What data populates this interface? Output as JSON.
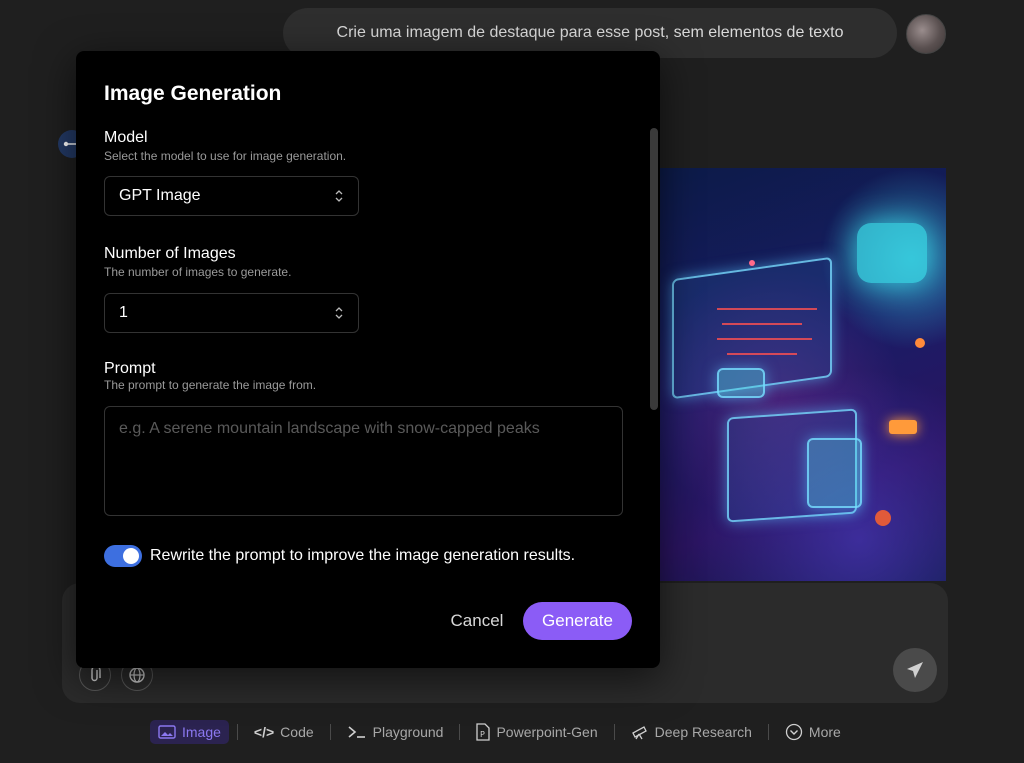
{
  "chat": {
    "user_message": "Crie uma imagem de destaque para esse post, sem elementos de texto"
  },
  "modal": {
    "title": "Image Generation",
    "model": {
      "label": "Model",
      "description": "Select the model to use for image generation.",
      "value": "GPT Image"
    },
    "num_images": {
      "label": "Number of Images",
      "description": "The number of images to generate.",
      "value": "1"
    },
    "prompt": {
      "label": "Prompt",
      "description": "The prompt to generate the image from.",
      "placeholder": "e.g. A serene mountain landscape with snow-capped peaks",
      "value": ""
    },
    "rewrite": {
      "label": "Rewrite the prompt to improve the image generation results.",
      "enabled": true
    },
    "cancel_label": "Cancel",
    "generate_label": "Generate"
  },
  "toolbar": {
    "items": [
      {
        "label": "Image",
        "icon": "image-icon",
        "active": true
      },
      {
        "label": "Code",
        "icon": "code-icon",
        "active": false
      },
      {
        "label": "Playground",
        "icon": "terminal-icon",
        "active": false
      },
      {
        "label": "Powerpoint-Gen",
        "icon": "file-ppt-icon",
        "active": false
      },
      {
        "label": "Deep Research",
        "icon": "telescope-icon",
        "active": false
      },
      {
        "label": "More",
        "icon": "chevron-down-circle-icon",
        "active": false
      }
    ]
  },
  "colors": {
    "accent": "#8b5cf6",
    "toggle_on": "#3d6fe0",
    "modal_bg": "#000000",
    "page_bg": "#1f1f1f"
  }
}
